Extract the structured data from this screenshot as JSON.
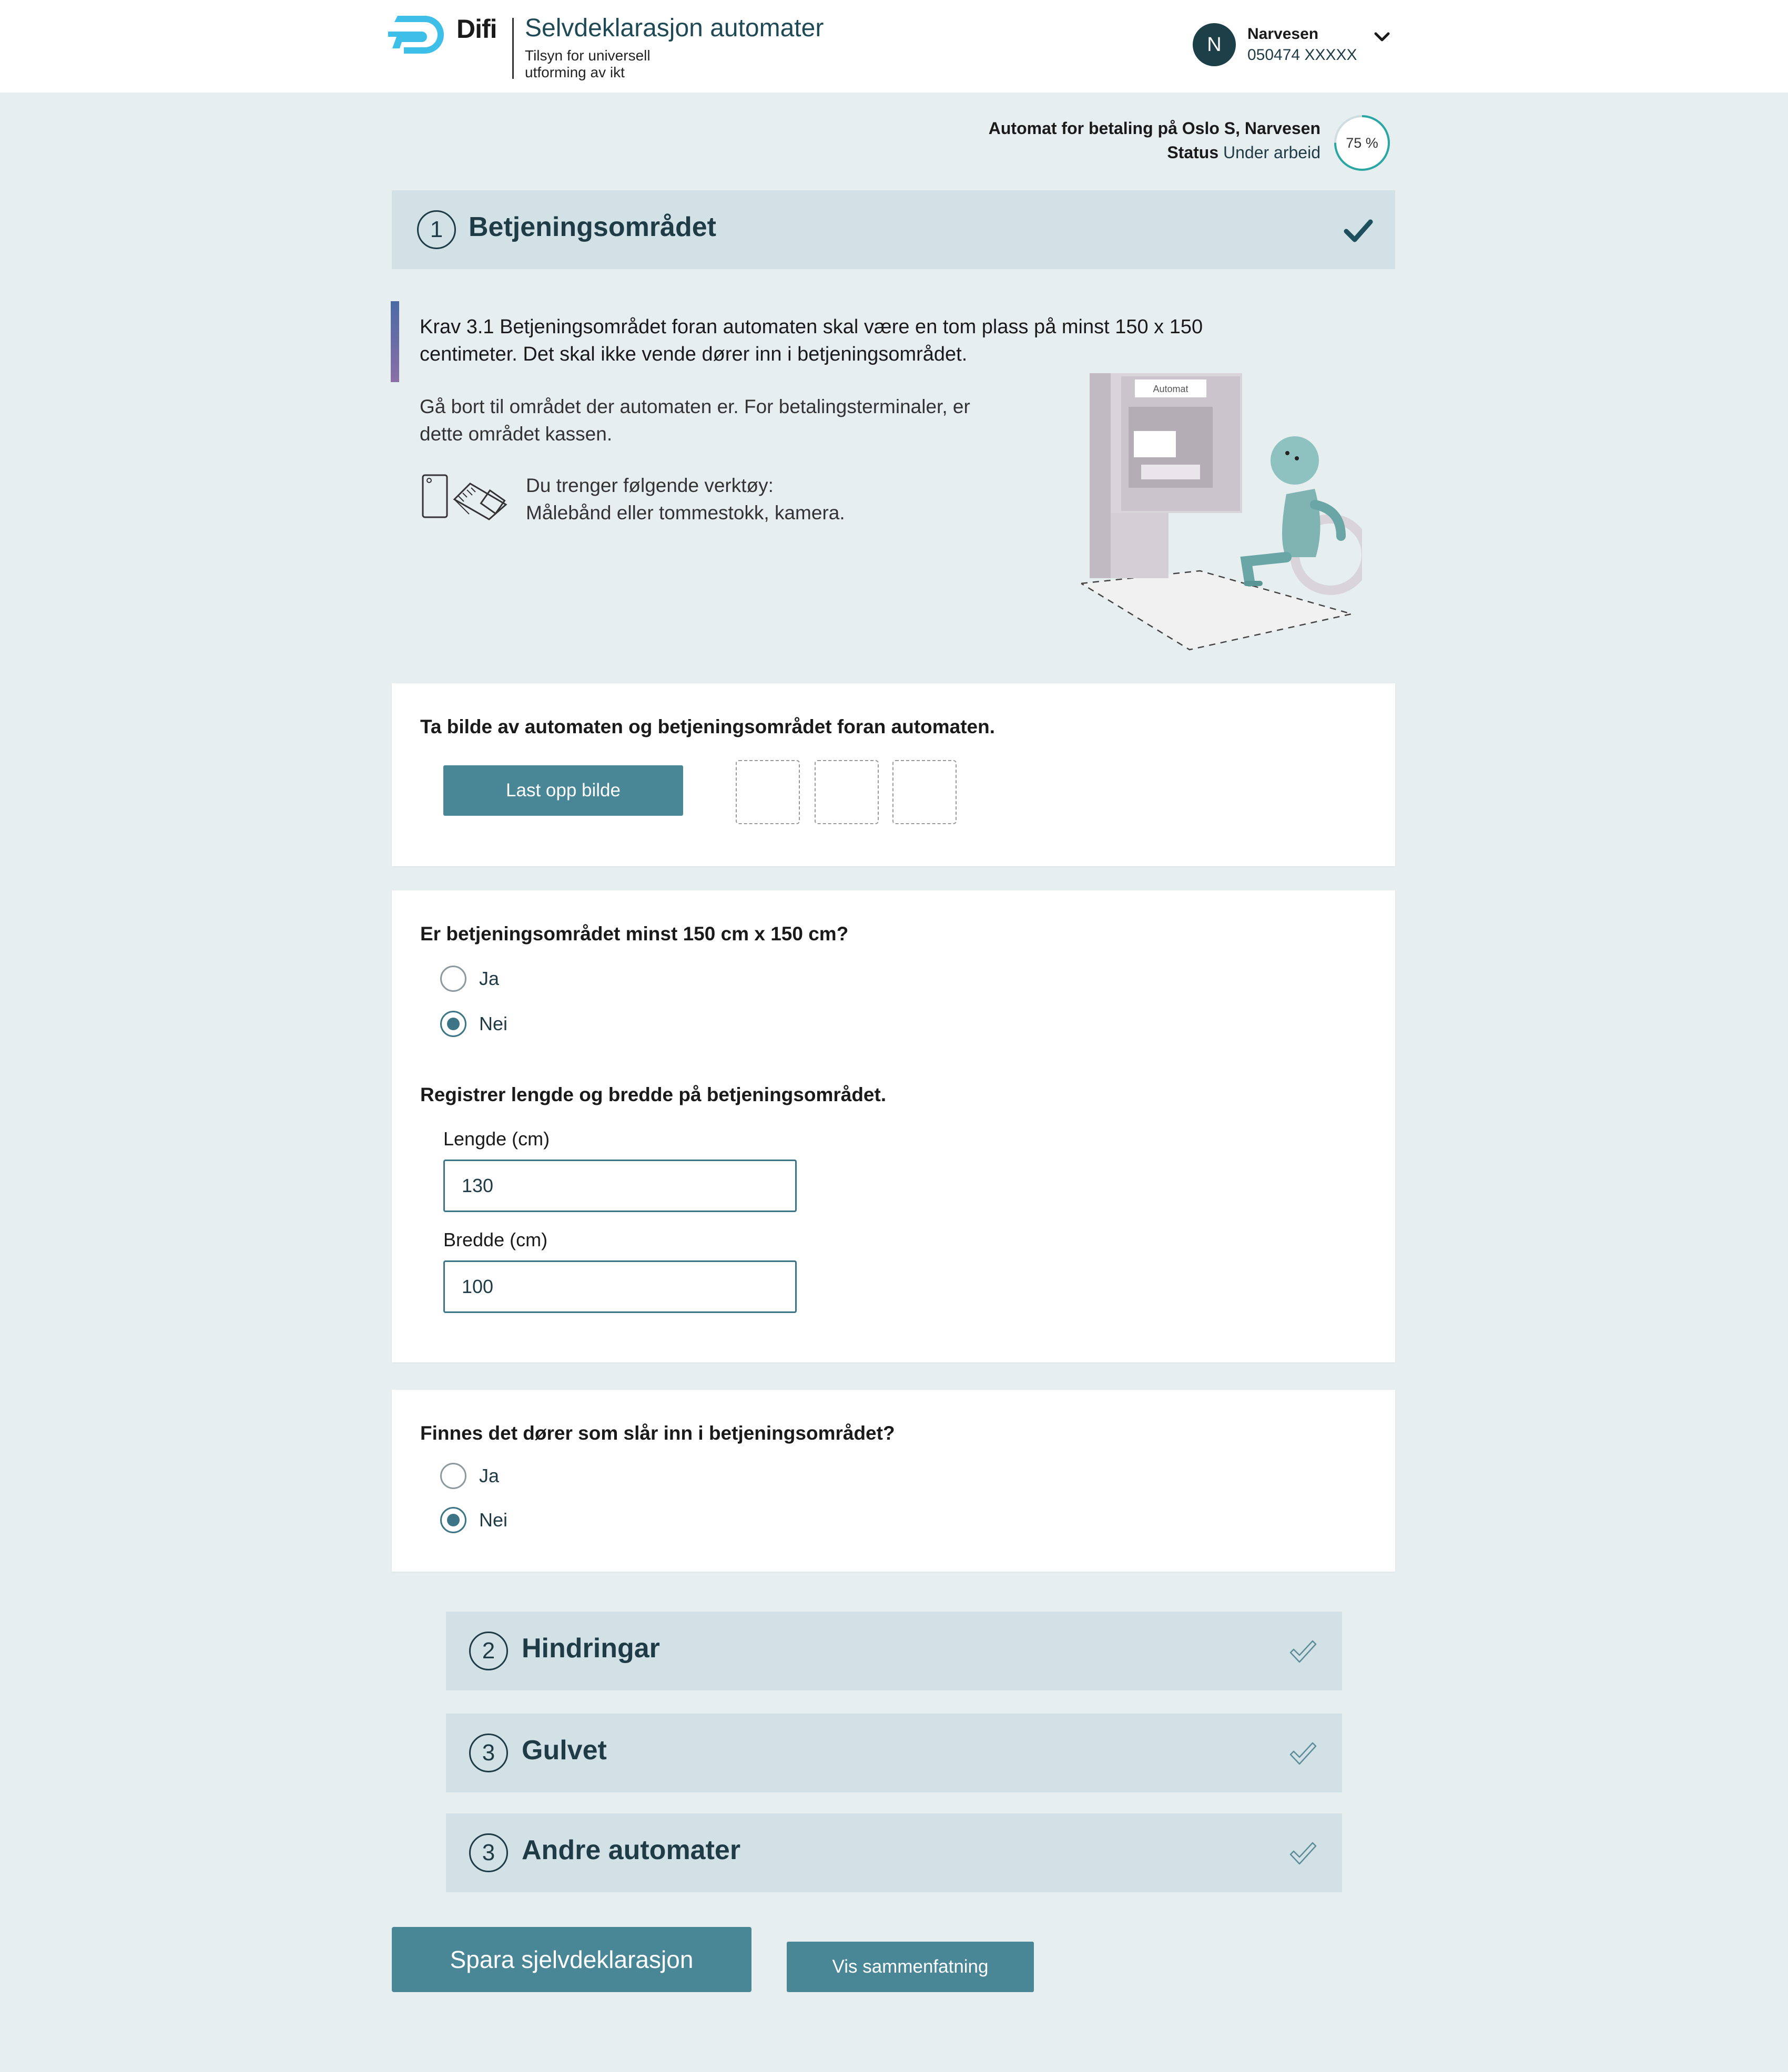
{
  "header": {
    "brand": "Difi",
    "title": "Selvdeklarasjon automater",
    "subtitle": "Tilsyn for universell utforming av ikt",
    "user": {
      "initial": "N",
      "name": "Narvesen",
      "id": "050474 XXXXX"
    }
  },
  "status": {
    "machine": "Automat for betaling på Oslo S, Narvesen",
    "status_label": "Status",
    "status_value": "Under arbeid",
    "progress_text": "75 %",
    "progress_fraction": 0.75
  },
  "sections": [
    {
      "number": "1",
      "title": "Betjeningsområdet"
    },
    {
      "number": "2",
      "title": "Hindringar"
    },
    {
      "number": "3",
      "title": "Gulvet"
    },
    {
      "number": "3",
      "title": "Andre automater"
    }
  ],
  "intro": {
    "krav": "Krav 3.1 Betjeningsområdet foran automaten skal være en tom plass på minst 150 x 150 centimeter. Det skal ikke vende dører inn i betjeningsområdet.",
    "instruction": "Gå bort til området der automaten er. For betalingsterminaler, er dette området kassen.",
    "tools_heading": "Du trenger følgende verktøy:",
    "tools": "Målebånd eller tommestokk, kamera.",
    "illustration_label": "Automat"
  },
  "photo_card": {
    "question": "Ta bilde av automaten og betjeningsområdet foran automaten.",
    "upload_label": "Last opp bilde"
  },
  "size_card": {
    "question": "Er betjeningsområdet minst 150 cm x 150 cm?",
    "options": [
      {
        "label": "Ja",
        "checked": false
      },
      {
        "label": "Nei",
        "checked": true
      }
    ],
    "register_heading": "Registrer lengde og bredde på betjeningsområdet.",
    "length_label": "Lengde (cm)",
    "length_value": "130",
    "width_label": "Bredde (cm)",
    "width_value": "100"
  },
  "door_card": {
    "question": "Finnes det dører som slår inn i betjeningsområdet?",
    "options": [
      {
        "label": "Ja",
        "checked": false
      },
      {
        "label": "Nei",
        "checked": true
      }
    ]
  },
  "actions": {
    "save": "Spara sjelvdeklarasjon",
    "summary": "Vis sammenfatning"
  },
  "colors": {
    "background": "#e6eef0",
    "section_bar": "#d1e1e6",
    "primary_button": "#4a8796",
    "dark_text": "#1f3b45",
    "logo_blue": "#3ebfe8"
  }
}
